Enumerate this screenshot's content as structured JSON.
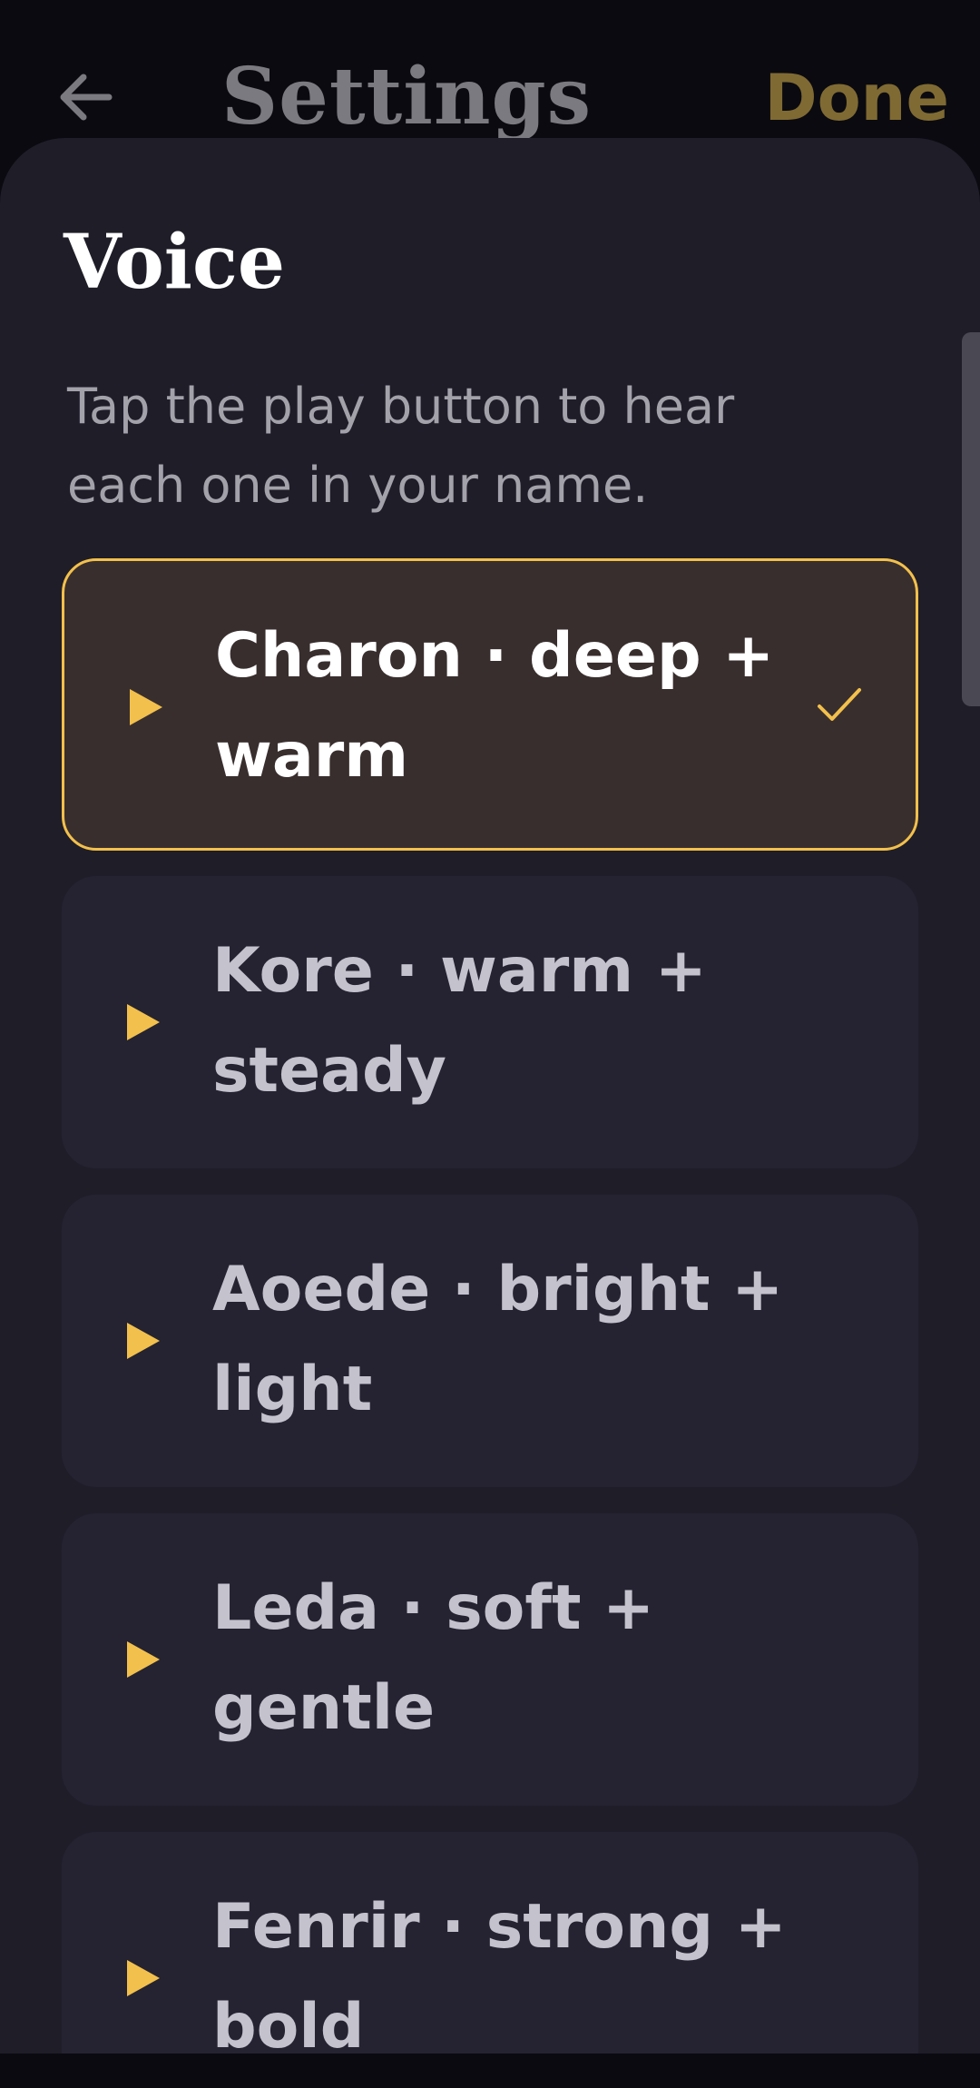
{
  "header": {
    "title": "Settings",
    "done_label": "Done",
    "back_icon": "arrow-left-icon"
  },
  "section": {
    "title": "Voice",
    "description": "Tap the play button to hear each one in your name."
  },
  "voices": [
    {
      "label": "Charon · deep + warm",
      "selected": true
    },
    {
      "label": "Kore · warm + steady",
      "selected": false
    },
    {
      "label": "Aoede · bright + light",
      "selected": false
    },
    {
      "label": "Leda · soft + gentle",
      "selected": false
    },
    {
      "label": "Fenrir · strong + bold",
      "selected": false
    }
  ],
  "colors": {
    "accent": "#f2c04c",
    "background": "#0b0a10",
    "sheet": "#1f1d28",
    "card": "#252331",
    "card_selected": "#392e2e",
    "done_dim": "#7f6a33"
  }
}
